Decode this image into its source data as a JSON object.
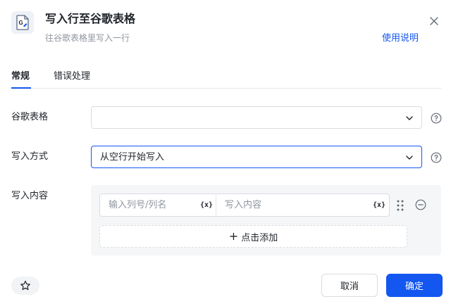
{
  "header": {
    "title": "写入行至谷歌表格",
    "subtitle": "往谷歌表格里写入一行",
    "help_link": "使用说明",
    "app_icon": "google-sheets-icon",
    "close_icon": "close-icon"
  },
  "tabs": [
    {
      "label": "常规",
      "active": true
    },
    {
      "label": "错误处理",
      "active": false
    }
  ],
  "form": {
    "sheet": {
      "label": "谷歌表格",
      "value": ""
    },
    "write_mode": {
      "label": "写入方式",
      "value": "从空行开始写入"
    },
    "content": {
      "label": "写入内容",
      "column_placeholder": "输入列号/列名",
      "value_placeholder": "写入内容",
      "variable_label": "{x}",
      "add_label": "点击添加"
    }
  },
  "footer": {
    "cancel_label": "取消",
    "confirm_label": "确定",
    "favorite_icon": "star-icon"
  },
  "colors": {
    "accent": "#1456f0",
    "border": "#d9dce1",
    "muted_text": "#8f959e"
  }
}
